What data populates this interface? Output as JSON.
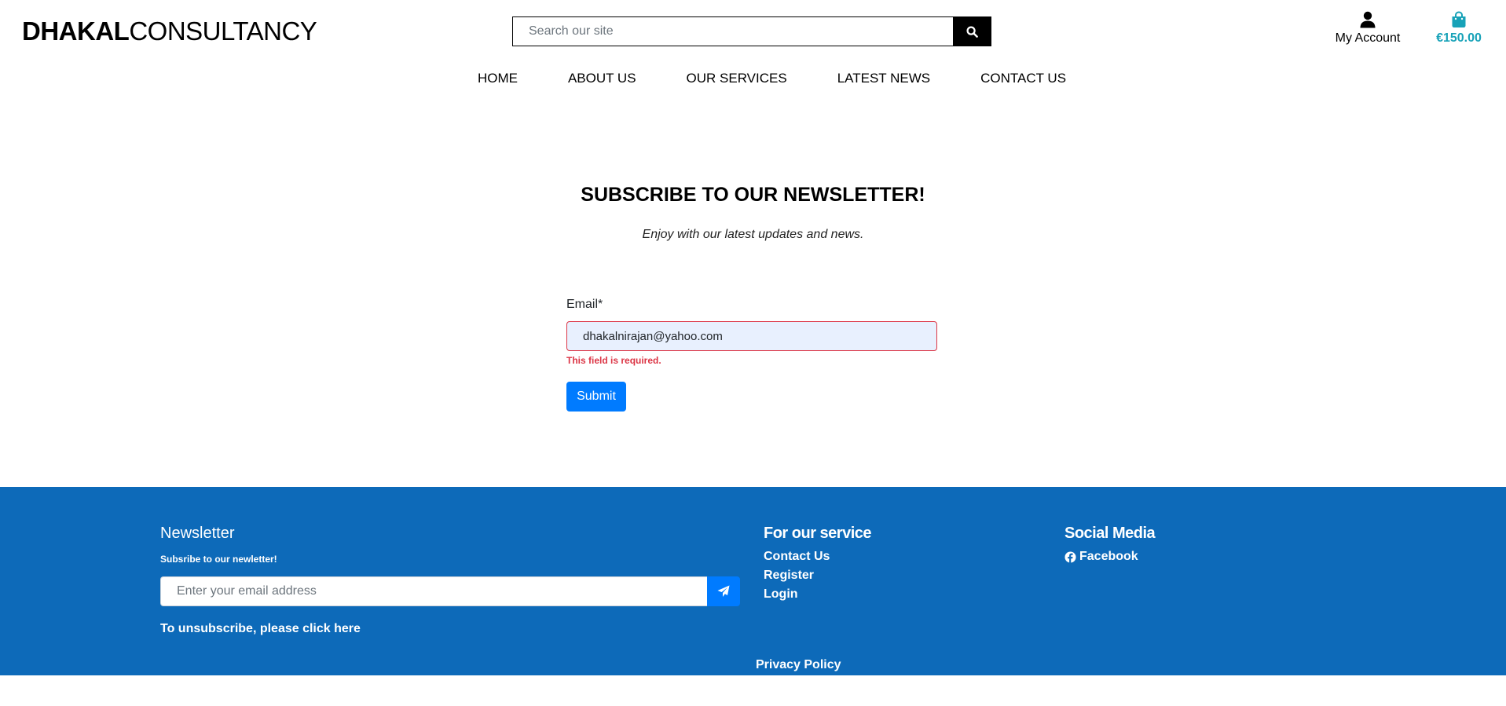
{
  "header": {
    "logo_bold": "DHAKAL",
    "logo_light": "CONSULTANCY",
    "search_placeholder": "Search our site",
    "account_label": "My Account",
    "bag_total": "€150.00",
    "accent_color": "#17a2b8"
  },
  "nav": {
    "items": [
      {
        "label": "HOME"
      },
      {
        "label": "ABOUT US"
      },
      {
        "label": "OUR SERVICES"
      },
      {
        "label": "LATEST NEWS"
      },
      {
        "label": "CONTACT US"
      }
    ]
  },
  "main": {
    "title": "SUBSCRIBE TO OUR NEWSLETTER!",
    "subtitle": "Enjoy with our latest updates and news.",
    "email_label": "Email*",
    "email_value": "dhakalnirajan@yahoo.com",
    "error_text": "This field is required.",
    "submit_label": "Submit"
  },
  "footer": {
    "background": "#0d6ab9",
    "newsletter_title": "Newsletter",
    "newsletter_sub": "Subsribe to our newletter!",
    "newsletter_placeholder": "Enter your email address",
    "unsubscribe_text": "To unsubscribe, please click here",
    "service_title": "For our service",
    "service_links": [
      {
        "label": "Contact Us"
      },
      {
        "label": "Register"
      },
      {
        "label": "Login"
      }
    ],
    "social_title": "Social Media",
    "facebook_label": "Facebook",
    "privacy_label": "Privacy Policy"
  },
  "icons": {
    "search": "search-icon",
    "account": "user-icon",
    "bag": "shopping-bag-icon",
    "send": "paper-plane-icon",
    "facebook": "facebook-icon"
  }
}
